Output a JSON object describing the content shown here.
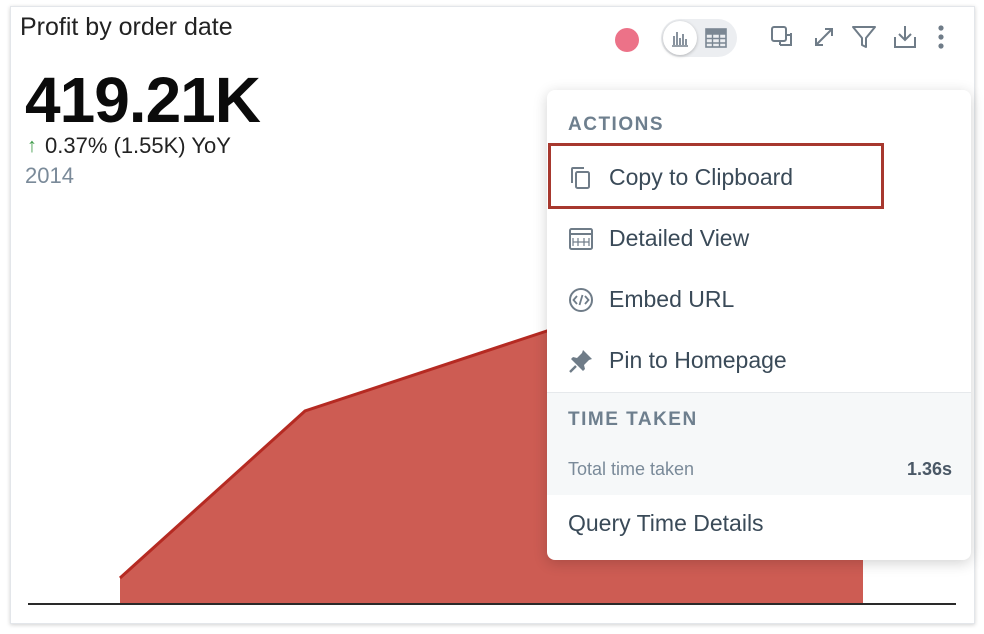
{
  "widget": {
    "title": "Profit by order date",
    "kpi_value": "419.21K",
    "delta_text": "0.37% (1.55K) YoY",
    "period": "2014"
  },
  "toolbar": {
    "color_dot": "#ec7288",
    "toggle_icons": [
      "bar-chart-icon",
      "table-icon"
    ],
    "tools": [
      "copy-icon",
      "expand-icon",
      "filter-icon",
      "download-icon",
      "more-vertical-icon"
    ]
  },
  "menu": {
    "actions_header": "ACTIONS",
    "items": [
      {
        "label": "Copy to Clipboard",
        "icon": "copy-icon"
      },
      {
        "label": "Detailed View",
        "icon": "raw-data-icon"
      },
      {
        "label": "Embed URL",
        "icon": "code-icon"
      },
      {
        "label": "Pin to Homepage",
        "icon": "pin-icon"
      }
    ],
    "time_header": "TIME TAKEN",
    "time_label": "Total time taken",
    "time_value": "1.36s",
    "query_details": "Query Time Details"
  },
  "colors": {
    "area_fill": "#cd5c53",
    "area_line": "#b52a22",
    "highlight_border": "#a7382e",
    "up_arrow": "#3f9b4a"
  }
}
